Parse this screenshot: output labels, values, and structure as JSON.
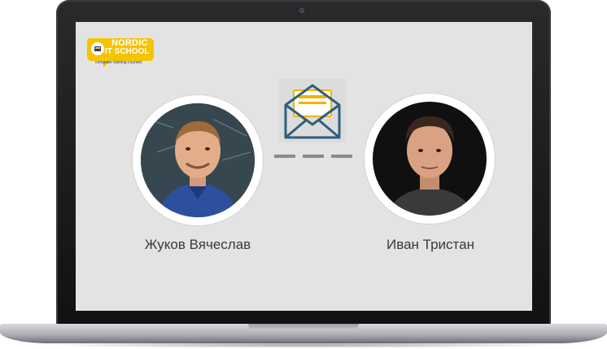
{
  "logo": {
    "line1": "NORDIC",
    "line2": "IT SCHOOL",
    "tagline": "computer training courses",
    "colors": {
      "badge": "#f5c400",
      "text": "#ffffff",
      "accent": "#2c3a7a"
    }
  },
  "connection": {
    "icon": "mail-envelope-icon",
    "colors": {
      "envelope": "#2f5f7a",
      "letter": "#f0b400",
      "dash": "#888a8d"
    }
  },
  "people": [
    {
      "name": "Жуков Вячеслав",
      "avatar": "person-photo-avatar"
    },
    {
      "name": "Иван Тристан",
      "avatar": "person-photo-avatar"
    }
  ]
}
